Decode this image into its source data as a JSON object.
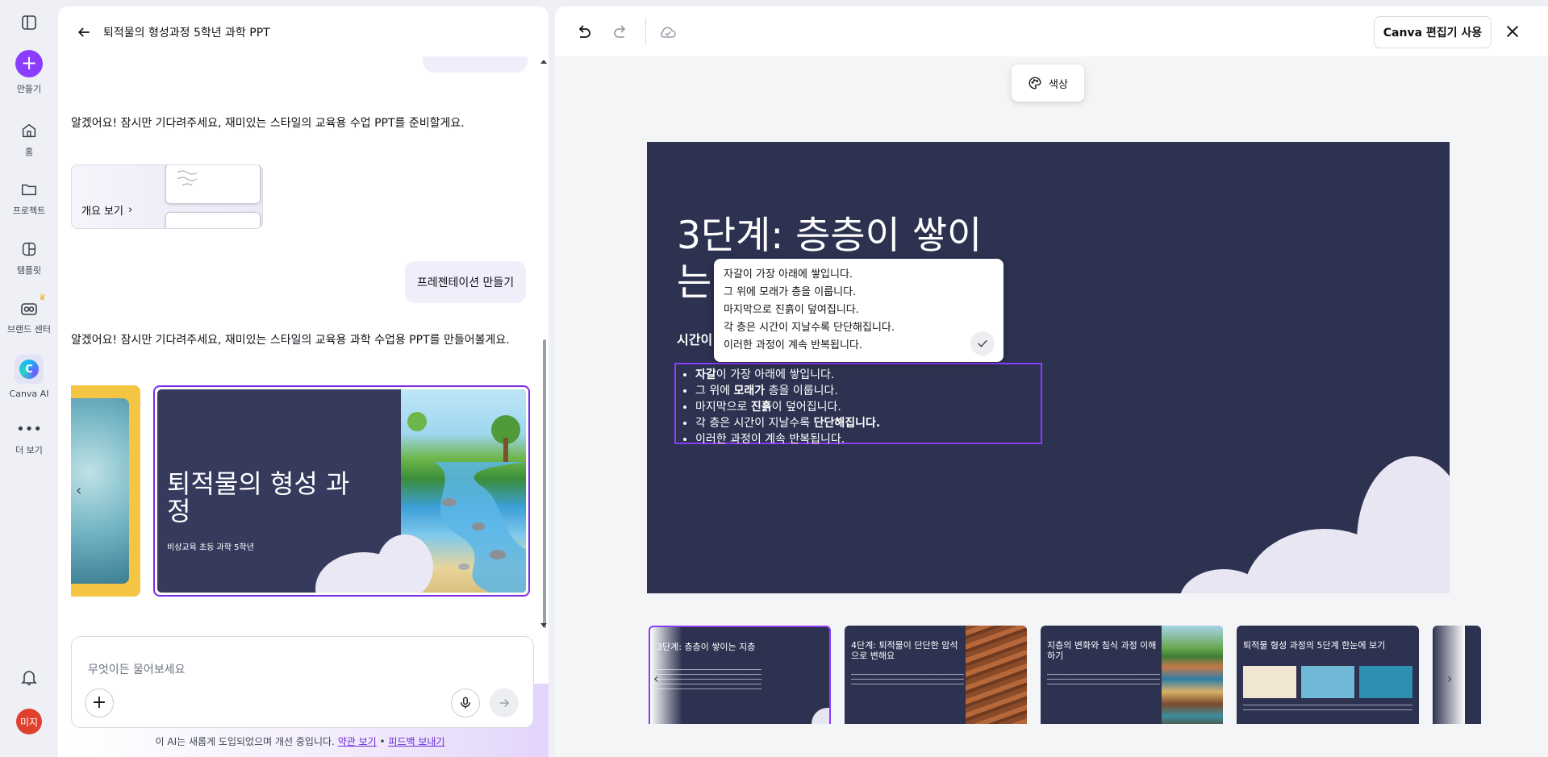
{
  "rail": {
    "items": [
      {
        "label": "만들기",
        "icon": "plus-icon"
      },
      {
        "label": "홈",
        "icon": "home-icon"
      },
      {
        "label": "프로젝트",
        "icon": "folder-icon"
      },
      {
        "label": "템플릿",
        "icon": "template-icon"
      },
      {
        "label": "브랜드 센터",
        "icon": "brand-icon"
      },
      {
        "label": "Canva AI",
        "icon": "canva-ai-icon"
      },
      {
        "label": "더 보기",
        "icon": "more-icon"
      }
    ],
    "avatar_initials": "미지",
    "brand_color": "#8b3dff"
  },
  "chat": {
    "title": "퇴적물의 형성과정 5학년 과학 PPT",
    "ai_message_1": "알겠어요! 잠시만 기다려주세요, 재미있는 스타일의 교육용 수업 PPT를 준비할게요.",
    "outline_button": "개요 보기",
    "user_message": "프레젠테이션 만들기",
    "ai_message_2": "알겠어요! 잠시만 기다려주세요, 재미있는 스타일의 교육용 과학 수업용 PPT를 만들어볼게요.",
    "preview_card": {
      "title": "퇴적물의 형성 과정",
      "subtitle": "비상교육 초등 과학 5학년"
    },
    "input_placeholder": "무엇이든 물어보세요",
    "footnote_prefix": "이 AI는 새롭게 도입되었으며 개선 중입니다.",
    "footnote_terms": "약관 보기",
    "footnote_sep": "•",
    "footnote_feedback": "피드백 보내기"
  },
  "editor": {
    "open_in_canva": "Canva 편집기 사용",
    "color_button": "색상",
    "slide": {
      "title": "3단계: 층층이 쌓이는 지층",
      "subtitle": "시간이",
      "bullets": [
        {
          "bold_a": "자갈",
          "text_a": "이 가장 아래에 쌓입니다.",
          "bold_b": "",
          "text_b": ""
        },
        {
          "bold_a": "",
          "text_a": "그 위에 ",
          "bold_b": "모래가",
          "text_b": " 층을 이룹니다."
        },
        {
          "bold_a": "",
          "text_a": "마지막으로 ",
          "bold_b": "진흙",
          "text_b": "이 덮어집니다."
        },
        {
          "bold_a": "",
          "text_a": "각 층은 시간이 지날수록 ",
          "bold_b": "단단해집니다.",
          "text_b": ""
        },
        {
          "bold_a": "",
          "text_a": "이러한 과정이 계속 반복됩니다.",
          "bold_b": "",
          "text_b": ""
        }
      ]
    },
    "popover_lines": [
      "자갈이 가장 아래에 쌓입니다.",
      "그 위에 모래가 층을 이룹니다.",
      "마지막으로 진흙이 덮여집니다.",
      "각 층은 시간이 지날수록 단단해집니다.",
      "이러한 과정이 계속 반복됩니다."
    ],
    "thumbnails": [
      {
        "title": "3단계: 층층이 쌓이는 지층",
        "art": "none"
      },
      {
        "title": "4단계: 퇴적물이 단단한 암석으로 변해요",
        "art": "rock"
      },
      {
        "title": "지층의 변화와 침식 과정 이해하기",
        "art": "strata"
      },
      {
        "title": "퇴적물 형성 과정의 5단계 한눈에 보기",
        "art": "grid"
      }
    ]
  }
}
